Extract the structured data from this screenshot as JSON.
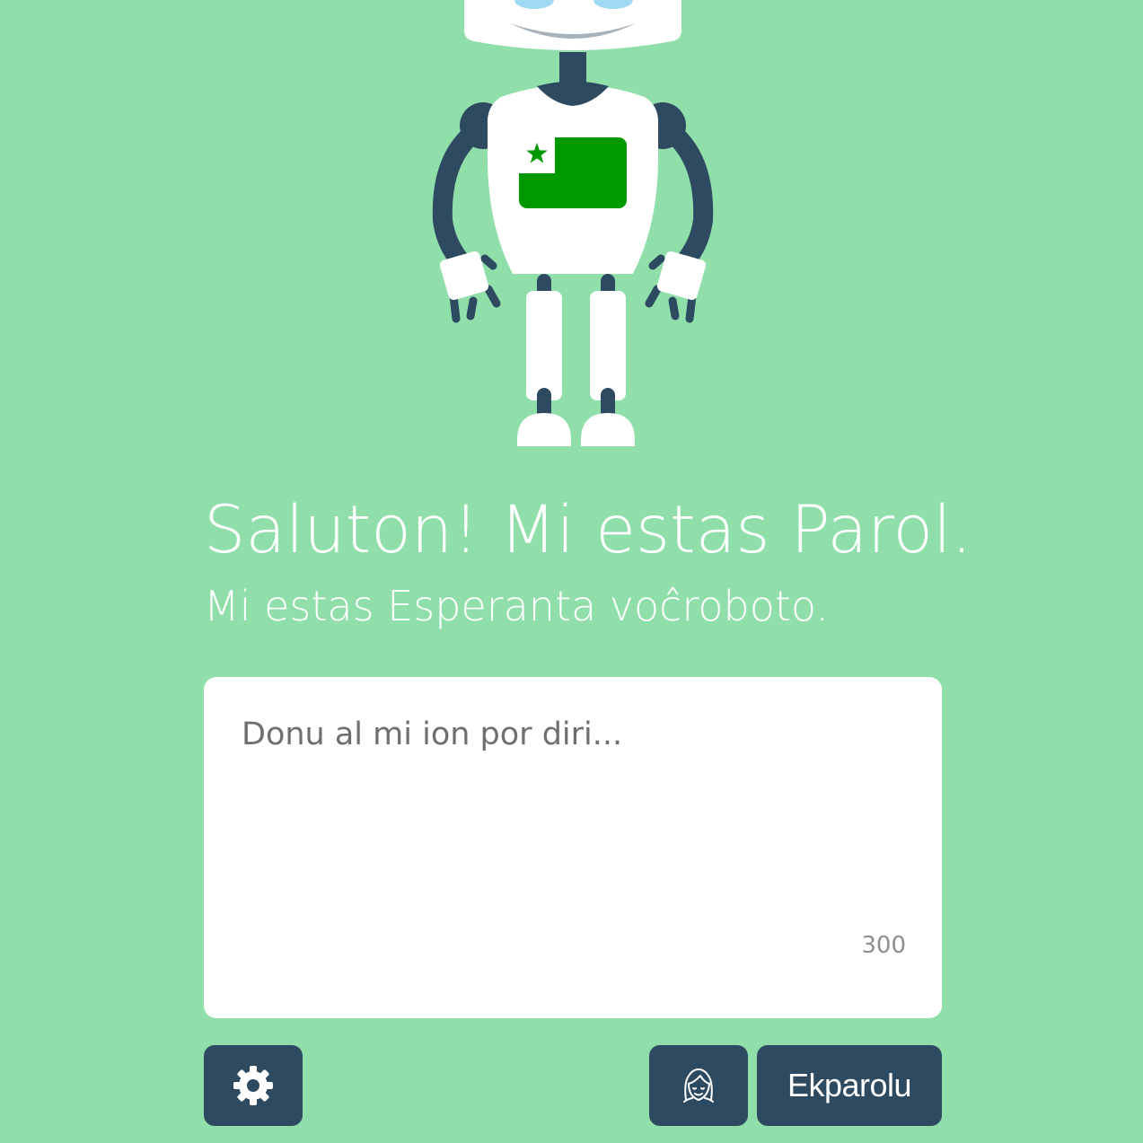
{
  "hero": {
    "title": "Saluton! Mi estas Parol.",
    "subtitle": "Mi estas Esperanta voĉroboto."
  },
  "input": {
    "placeholder": "Donu al mi ion por diri...",
    "value": "",
    "char_counter": "300"
  },
  "buttons": {
    "settings_icon": "gear-icon",
    "voice_icon": "female-face-icon",
    "speak_label": "Ekparolu"
  },
  "colors": {
    "background": "#90dfab",
    "button": "#2e4a61",
    "flag_green": "#009900",
    "robot_dark": "#2e4a61"
  },
  "robot": {
    "icon": "robot-illustration",
    "chest_flag": "esperanto-flag-icon"
  }
}
